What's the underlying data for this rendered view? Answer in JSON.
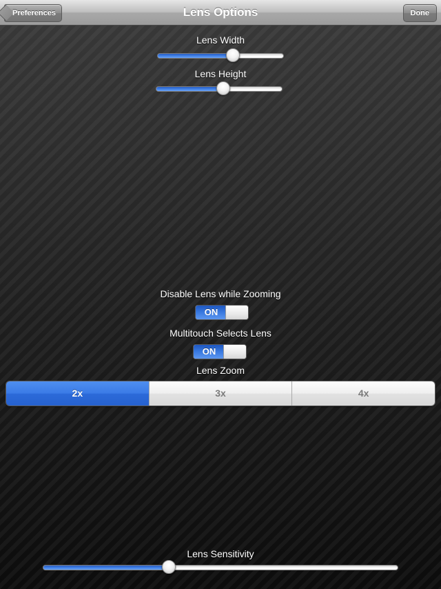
{
  "navbar": {
    "title": "Lens Options",
    "back_label": "Preferences",
    "done_label": "Done"
  },
  "lens_width": {
    "label": "Lens Width",
    "value": 0.6
  },
  "lens_height": {
    "label": "Lens Height",
    "value": 0.53
  },
  "disable_lens_while_zooming": {
    "label": "Disable Lens while Zooming",
    "state": "ON"
  },
  "multitouch_selects_lens": {
    "label": "Multitouch Selects Lens",
    "state": "ON"
  },
  "lens_zoom": {
    "label": "Lens Zoom",
    "options": [
      "2x",
      "3x",
      "4x"
    ],
    "selected": "2x"
  },
  "lens_sensitivity": {
    "label": "Lens Sensitivity",
    "value": 0.355
  },
  "colors": {
    "accent_blue": "#3a7ae6",
    "navbar_gray": "#b0b0b0",
    "background": "#1a1a1a"
  }
}
